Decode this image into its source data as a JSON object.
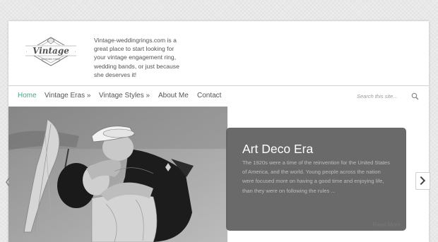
{
  "header": {
    "logo": {
      "wordmark": "Vintage",
      "subtext": "WEDDING RINGS"
    },
    "tagline": "Vintage-weddingrings.com is a great place to start looking for your vintage engagement ring, wedding bands, or just because she deserves it!"
  },
  "nav": {
    "items": [
      {
        "label": "Home",
        "active": true
      },
      {
        "label": "Vintage Eras »",
        "active": false
      },
      {
        "label": "Vintage Styles »",
        "active": false
      },
      {
        "label": "About Me",
        "active": false
      },
      {
        "label": "Contact",
        "active": false
      }
    ],
    "search": {
      "placeholder": "Search this site...",
      "icon": "search-icon"
    }
  },
  "slider": {
    "photo": "black-and-white sailor kissing woman with umbrella",
    "title": "Art Deco Era",
    "excerpt": "The 1920s were a time of the reinvention for the United States of America, and the world. Young people across the nation were focused more on having a good time and enjoying life, than they were on following the rules ...",
    "read_more": "Read More",
    "next_icon": "chevron-right-icon",
    "prev_icon": "chevron-left-icon"
  },
  "colors": {
    "accent": "#4fa58d",
    "caption_bg": "#5f5f5f",
    "nav_text": "#555555",
    "page_bg": "#ececec"
  }
}
